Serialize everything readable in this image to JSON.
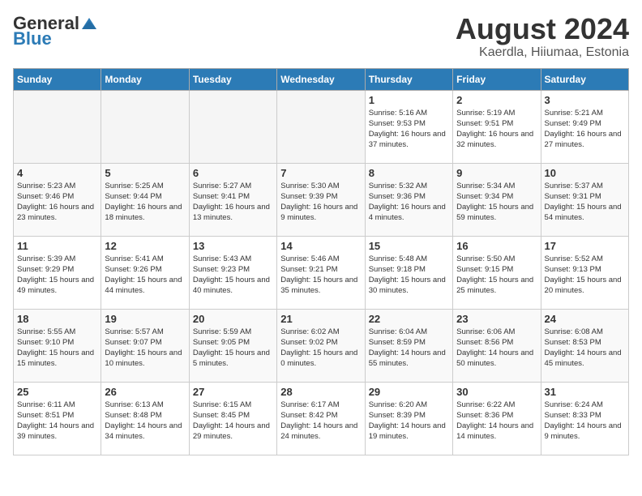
{
  "header": {
    "logo_general": "General",
    "logo_blue": "Blue",
    "month_title": "August 2024",
    "location": "Kaerdla, Hiiumaa, Estonia"
  },
  "weekdays": [
    "Sunday",
    "Monday",
    "Tuesday",
    "Wednesday",
    "Thursday",
    "Friday",
    "Saturday"
  ],
  "weeks": [
    [
      {
        "day": "",
        "empty": true
      },
      {
        "day": "",
        "empty": true
      },
      {
        "day": "",
        "empty": true
      },
      {
        "day": "",
        "empty": true
      },
      {
        "day": "1",
        "sunrise": "5:16 AM",
        "sunset": "9:53 PM",
        "daylight": "16 hours and 37 minutes."
      },
      {
        "day": "2",
        "sunrise": "5:19 AM",
        "sunset": "9:51 PM",
        "daylight": "16 hours and 32 minutes."
      },
      {
        "day": "3",
        "sunrise": "5:21 AM",
        "sunset": "9:49 PM",
        "daylight": "16 hours and 27 minutes."
      }
    ],
    [
      {
        "day": "4",
        "sunrise": "5:23 AM",
        "sunset": "9:46 PM",
        "daylight": "16 hours and 23 minutes."
      },
      {
        "day": "5",
        "sunrise": "5:25 AM",
        "sunset": "9:44 PM",
        "daylight": "16 hours and 18 minutes."
      },
      {
        "day": "6",
        "sunrise": "5:27 AM",
        "sunset": "9:41 PM",
        "daylight": "16 hours and 13 minutes."
      },
      {
        "day": "7",
        "sunrise": "5:30 AM",
        "sunset": "9:39 PM",
        "daylight": "16 hours and 9 minutes."
      },
      {
        "day": "8",
        "sunrise": "5:32 AM",
        "sunset": "9:36 PM",
        "daylight": "16 hours and 4 minutes."
      },
      {
        "day": "9",
        "sunrise": "5:34 AM",
        "sunset": "9:34 PM",
        "daylight": "15 hours and 59 minutes."
      },
      {
        "day": "10",
        "sunrise": "5:37 AM",
        "sunset": "9:31 PM",
        "daylight": "15 hours and 54 minutes."
      }
    ],
    [
      {
        "day": "11",
        "sunrise": "5:39 AM",
        "sunset": "9:29 PM",
        "daylight": "15 hours and 49 minutes."
      },
      {
        "day": "12",
        "sunrise": "5:41 AM",
        "sunset": "9:26 PM",
        "daylight": "15 hours and 44 minutes."
      },
      {
        "day": "13",
        "sunrise": "5:43 AM",
        "sunset": "9:23 PM",
        "daylight": "15 hours and 40 minutes."
      },
      {
        "day": "14",
        "sunrise": "5:46 AM",
        "sunset": "9:21 PM",
        "daylight": "15 hours and 35 minutes."
      },
      {
        "day": "15",
        "sunrise": "5:48 AM",
        "sunset": "9:18 PM",
        "daylight": "15 hours and 30 minutes."
      },
      {
        "day": "16",
        "sunrise": "5:50 AM",
        "sunset": "9:15 PM",
        "daylight": "15 hours and 25 minutes."
      },
      {
        "day": "17",
        "sunrise": "5:52 AM",
        "sunset": "9:13 PM",
        "daylight": "15 hours and 20 minutes."
      }
    ],
    [
      {
        "day": "18",
        "sunrise": "5:55 AM",
        "sunset": "9:10 PM",
        "daylight": "15 hours and 15 minutes."
      },
      {
        "day": "19",
        "sunrise": "5:57 AM",
        "sunset": "9:07 PM",
        "daylight": "15 hours and 10 minutes."
      },
      {
        "day": "20",
        "sunrise": "5:59 AM",
        "sunset": "9:05 PM",
        "daylight": "15 hours and 5 minutes."
      },
      {
        "day": "21",
        "sunrise": "6:02 AM",
        "sunset": "9:02 PM",
        "daylight": "15 hours and 0 minutes."
      },
      {
        "day": "22",
        "sunrise": "6:04 AM",
        "sunset": "8:59 PM",
        "daylight": "14 hours and 55 minutes."
      },
      {
        "day": "23",
        "sunrise": "6:06 AM",
        "sunset": "8:56 PM",
        "daylight": "14 hours and 50 minutes."
      },
      {
        "day": "24",
        "sunrise": "6:08 AM",
        "sunset": "8:53 PM",
        "daylight": "14 hours and 45 minutes."
      }
    ],
    [
      {
        "day": "25",
        "sunrise": "6:11 AM",
        "sunset": "8:51 PM",
        "daylight": "14 hours and 39 minutes."
      },
      {
        "day": "26",
        "sunrise": "6:13 AM",
        "sunset": "8:48 PM",
        "daylight": "14 hours and 34 minutes."
      },
      {
        "day": "27",
        "sunrise": "6:15 AM",
        "sunset": "8:45 PM",
        "daylight": "14 hours and 29 minutes."
      },
      {
        "day": "28",
        "sunrise": "6:17 AM",
        "sunset": "8:42 PM",
        "daylight": "14 hours and 24 minutes."
      },
      {
        "day": "29",
        "sunrise": "6:20 AM",
        "sunset": "8:39 PM",
        "daylight": "14 hours and 19 minutes."
      },
      {
        "day": "30",
        "sunrise": "6:22 AM",
        "sunset": "8:36 PM",
        "daylight": "14 hours and 14 minutes."
      },
      {
        "day": "31",
        "sunrise": "6:24 AM",
        "sunset": "8:33 PM",
        "daylight": "14 hours and 9 minutes."
      }
    ]
  ]
}
